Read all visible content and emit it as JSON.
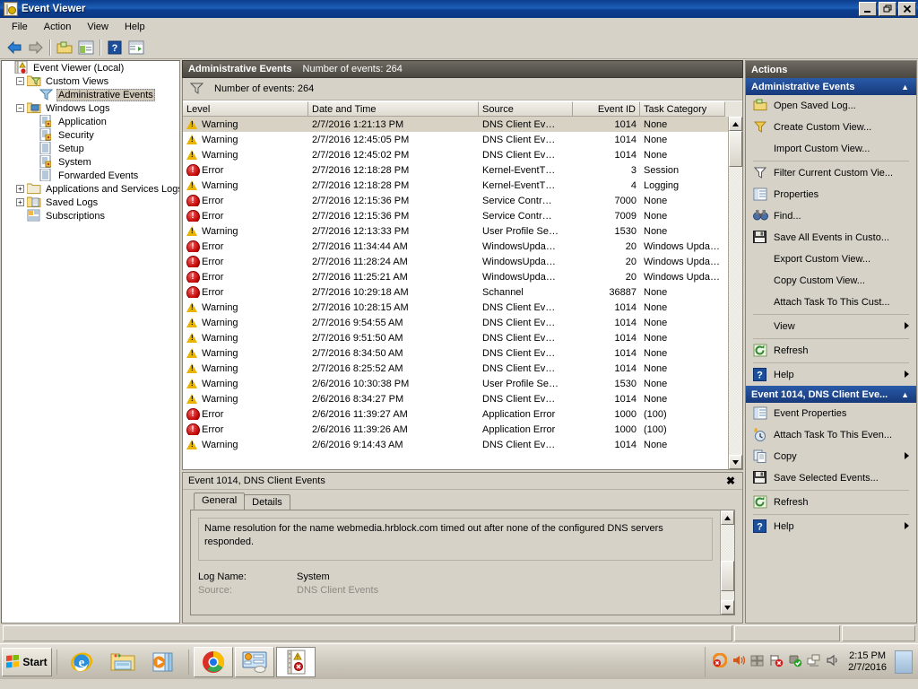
{
  "window": {
    "title": "Event Viewer",
    "icon": "event-viewer-icon",
    "buttons": {
      "minimize": "_",
      "maximize": "❐",
      "close": "✕"
    }
  },
  "menubar": {
    "items": [
      "File",
      "Action",
      "View",
      "Help"
    ]
  },
  "toolbar": {
    "items": [
      {
        "name": "back-button",
        "icon": "left-arrow-icon"
      },
      {
        "name": "forward-button",
        "icon": "right-arrow-icon"
      },
      {
        "name": "open-button",
        "icon": "folder-open-icon"
      },
      {
        "name": "show-hide-tree-button",
        "icon": "console-tree-icon"
      },
      {
        "name": "help-button",
        "icon": "question-mark-icon"
      },
      {
        "name": "show-action-pane-button",
        "icon": "action-pane-icon"
      }
    ]
  },
  "tree": {
    "nodes": [
      {
        "label": "Event Viewer (Local)",
        "indent": 0,
        "expander": "",
        "icon": "event-viewer-icon",
        "selected": false
      },
      {
        "label": "Custom Views",
        "indent": 1,
        "expander": "-",
        "icon": "custom-views-folder-icon",
        "selected": false
      },
      {
        "label": "Administrative Events",
        "indent": 2,
        "expander": "",
        "icon": "funnel-icon",
        "selected": true
      },
      {
        "label": "Windows Logs",
        "indent": 1,
        "expander": "-",
        "icon": "windows-logs-folder-icon",
        "selected": false
      },
      {
        "label": "Application",
        "indent": 2,
        "expander": "",
        "icon": "log-locked-icon",
        "selected": false
      },
      {
        "label": "Security",
        "indent": 2,
        "expander": "",
        "icon": "log-locked-icon",
        "selected": false
      },
      {
        "label": "Setup",
        "indent": 2,
        "expander": "",
        "icon": "log-icon",
        "selected": false
      },
      {
        "label": "System",
        "indent": 2,
        "expander": "",
        "icon": "log-locked-icon",
        "selected": false
      },
      {
        "label": "Forwarded Events",
        "indent": 2,
        "expander": "",
        "icon": "log-icon",
        "selected": false
      },
      {
        "label": "Applications and Services Logs",
        "indent": 1,
        "expander": "+",
        "icon": "folder-icon",
        "selected": false
      },
      {
        "label": "Saved Logs",
        "indent": 1,
        "expander": "+",
        "icon": "saved-logs-folder-icon",
        "selected": false
      },
      {
        "label": "Subscriptions",
        "indent": 1,
        "expander": "",
        "icon": "subscriptions-icon",
        "selected": false
      }
    ]
  },
  "center": {
    "header": {
      "title": "Administrative Events",
      "count_label": "Number of events: 264"
    },
    "filter_bar": {
      "icon": "funnel-icon",
      "label": "Number of events: 264"
    },
    "columns": [
      {
        "label": "Level",
        "width": 140,
        "align": "left"
      },
      {
        "label": "Date and Time",
        "width": 190,
        "align": "left"
      },
      {
        "label": "Source",
        "width": 105,
        "align": "left"
      },
      {
        "label": "Event ID",
        "width": 75,
        "align": "right"
      },
      {
        "label": "Task Category",
        "width": 95,
        "align": "left"
      }
    ],
    "rows": [
      {
        "level": "Warning",
        "datetime": "2/7/2016 1:21:13 PM",
        "source": "DNS Client Ev…",
        "event_id": "1014",
        "task": "None",
        "selected": true
      },
      {
        "level": "Warning",
        "datetime": "2/7/2016 12:45:05 PM",
        "source": "DNS Client Ev…",
        "event_id": "1014",
        "task": "None",
        "selected": false
      },
      {
        "level": "Warning",
        "datetime": "2/7/2016 12:45:02 PM",
        "source": "DNS Client Ev…",
        "event_id": "1014",
        "task": "None",
        "selected": false
      },
      {
        "level": "Error",
        "datetime": "2/7/2016 12:18:28 PM",
        "source": "Kernel-EventT…",
        "event_id": "3",
        "task": "Session",
        "selected": false
      },
      {
        "level": "Warning",
        "datetime": "2/7/2016 12:18:28 PM",
        "source": "Kernel-EventT…",
        "event_id": "4",
        "task": "Logging",
        "selected": false
      },
      {
        "level": "Error",
        "datetime": "2/7/2016 12:15:36 PM",
        "source": "Service Contr…",
        "event_id": "7000",
        "task": "None",
        "selected": false
      },
      {
        "level": "Error",
        "datetime": "2/7/2016 12:15:36 PM",
        "source": "Service Contr…",
        "event_id": "7009",
        "task": "None",
        "selected": false
      },
      {
        "level": "Warning",
        "datetime": "2/7/2016 12:13:33 PM",
        "source": "User Profile Se…",
        "event_id": "1530",
        "task": "None",
        "selected": false
      },
      {
        "level": "Error",
        "datetime": "2/7/2016 11:34:44 AM",
        "source": "WindowsUpda…",
        "event_id": "20",
        "task": "Windows Upda…",
        "selected": false
      },
      {
        "level": "Error",
        "datetime": "2/7/2016 11:28:24 AM",
        "source": "WindowsUpda…",
        "event_id": "20",
        "task": "Windows Upda…",
        "selected": false
      },
      {
        "level": "Error",
        "datetime": "2/7/2016 11:25:21 AM",
        "source": "WindowsUpda…",
        "event_id": "20",
        "task": "Windows Upda…",
        "selected": false
      },
      {
        "level": "Error",
        "datetime": "2/7/2016 10:29:18 AM",
        "source": "Schannel",
        "event_id": "36887",
        "task": "None",
        "selected": false
      },
      {
        "level": "Warning",
        "datetime": "2/7/2016 10:28:15 AM",
        "source": "DNS Client Ev…",
        "event_id": "1014",
        "task": "None",
        "selected": false
      },
      {
        "level": "Warning",
        "datetime": "2/7/2016 9:54:55 AM",
        "source": "DNS Client Ev…",
        "event_id": "1014",
        "task": "None",
        "selected": false
      },
      {
        "level": "Warning",
        "datetime": "2/7/2016 9:51:50 AM",
        "source": "DNS Client Ev…",
        "event_id": "1014",
        "task": "None",
        "selected": false
      },
      {
        "level": "Warning",
        "datetime": "2/7/2016 8:34:50 AM",
        "source": "DNS Client Ev…",
        "event_id": "1014",
        "task": "None",
        "selected": false
      },
      {
        "level": "Warning",
        "datetime": "2/7/2016 8:25:52 AM",
        "source": "DNS Client Ev…",
        "event_id": "1014",
        "task": "None",
        "selected": false
      },
      {
        "level": "Warning",
        "datetime": "2/6/2016 10:30:38 PM",
        "source": "User Profile Se…",
        "event_id": "1530",
        "task": "None",
        "selected": false
      },
      {
        "level": "Warning",
        "datetime": "2/6/2016 8:34:27 PM",
        "source": "DNS Client Ev…",
        "event_id": "1014",
        "task": "None",
        "selected": false
      },
      {
        "level": "Error",
        "datetime": "2/6/2016 11:39:27 AM",
        "source": "Application Error",
        "event_id": "1000",
        "task": "(100)",
        "selected": false
      },
      {
        "level": "Error",
        "datetime": "2/6/2016 11:39:26 AM",
        "source": "Application Error",
        "event_id": "1000",
        "task": "(100)",
        "selected": false
      },
      {
        "level": "Warning",
        "datetime": "2/6/2016 9:14:43 AM",
        "source": "DNS Client Ev…",
        "event_id": "1014",
        "task": "None",
        "selected": false
      }
    ]
  },
  "detail": {
    "title": "Event 1014, DNS Client Events",
    "close_label": "✖",
    "tabs": [
      {
        "label": "General",
        "active": true
      },
      {
        "label": "Details",
        "active": false
      }
    ],
    "message": "Name resolution for the name webmedia.hrblock.com timed out after none of the configured DNS servers responded.",
    "fields": [
      {
        "key": "Log Name:",
        "value": "System"
      },
      {
        "key": "Source:",
        "value": "DNS Client Events"
      }
    ]
  },
  "actions": {
    "header": "Actions",
    "groups": [
      {
        "title": "Administrative Events",
        "caret": "▲",
        "items": [
          {
            "label": "Open Saved Log...",
            "icon": "open-folder-icon",
            "submenu": false,
            "sep_after": false
          },
          {
            "label": "Create Custom View...",
            "icon": "create-funnel-icon",
            "submenu": false,
            "sep_after": false
          },
          {
            "label": "Import Custom View...",
            "icon": "",
            "submenu": false,
            "sep_after": true
          },
          {
            "label": "Filter Current Custom Vie...",
            "icon": "funnel-icon",
            "submenu": false,
            "sep_after": false
          },
          {
            "label": "Properties",
            "icon": "properties-icon",
            "submenu": false,
            "sep_after": false
          },
          {
            "label": "Find...",
            "icon": "binoculars-icon",
            "submenu": false,
            "sep_after": false
          },
          {
            "label": "Save All Events in Custo...",
            "icon": "save-icon",
            "submenu": false,
            "sep_after": false
          },
          {
            "label": "Export Custom View...",
            "icon": "",
            "submenu": false,
            "sep_after": false
          },
          {
            "label": "Copy Custom View...",
            "icon": "",
            "submenu": false,
            "sep_after": false
          },
          {
            "label": "Attach Task To This Cust...",
            "icon": "",
            "submenu": false,
            "sep_after": true
          },
          {
            "label": "View",
            "icon": "",
            "submenu": true,
            "sep_after": true
          },
          {
            "label": "Refresh",
            "icon": "refresh-icon",
            "submenu": false,
            "sep_after": true
          },
          {
            "label": "Help",
            "icon": "help-icon",
            "submenu": true,
            "sep_after": false
          }
        ]
      },
      {
        "title": "Event 1014, DNS Client Eve...",
        "caret": "▲",
        "items": [
          {
            "label": "Event Properties",
            "icon": "properties-icon",
            "submenu": false,
            "sep_after": false
          },
          {
            "label": "Attach Task To This Even...",
            "icon": "attach-task-icon",
            "submenu": false,
            "sep_after": false
          },
          {
            "label": "Copy",
            "icon": "copy-icon",
            "submenu": true,
            "sep_after": false
          },
          {
            "label": "Save Selected Events...",
            "icon": "save-icon",
            "submenu": false,
            "sep_after": true
          },
          {
            "label": "Refresh",
            "icon": "refresh-icon",
            "submenu": false,
            "sep_after": true
          },
          {
            "label": "Help",
            "icon": "help-icon",
            "submenu": true,
            "sep_after": false
          }
        ]
      }
    ]
  },
  "taskbar": {
    "start_label": "Start",
    "quick_launch": [
      {
        "name": "internet-explorer-icon"
      },
      {
        "name": "file-explorer-icon"
      },
      {
        "name": "media-player-icon"
      }
    ],
    "tasks": [
      {
        "name": "chrome-icon",
        "active": false
      },
      {
        "name": "server-manager-icon",
        "active": false
      },
      {
        "name": "event-viewer-icon",
        "active": true
      }
    ],
    "tray": [
      {
        "name": "action-center-alert-icon"
      },
      {
        "name": "volume-icon"
      },
      {
        "name": "windows-flag-icon"
      },
      {
        "name": "flag-alert-icon"
      },
      {
        "name": "security-shield-ok-icon"
      },
      {
        "name": "network-icon"
      },
      {
        "name": "speaker-icon"
      }
    ],
    "clock": {
      "time": "2:15 PM",
      "date": "2/7/2016"
    }
  }
}
